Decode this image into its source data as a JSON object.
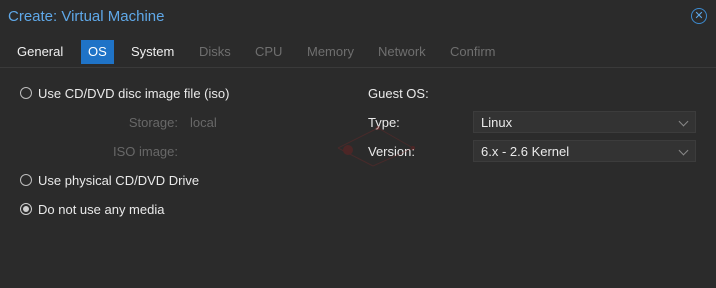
{
  "window": {
    "title": "Create: Virtual Machine",
    "close_icon": "close-circle-icon"
  },
  "tabs": [
    {
      "label": "General",
      "state": "enabled"
    },
    {
      "label": "OS",
      "state": "active"
    },
    {
      "label": "System",
      "state": "enabled"
    },
    {
      "label": "Disks",
      "state": "disabled"
    },
    {
      "label": "CPU",
      "state": "disabled"
    },
    {
      "label": "Memory",
      "state": "disabled"
    },
    {
      "label": "Network",
      "state": "disabled"
    },
    {
      "label": "Confirm",
      "state": "disabled"
    }
  ],
  "media": {
    "iso_option": {
      "label": "Use CD/DVD disc image file (iso)",
      "checked": false
    },
    "storage": {
      "label": "Storage:",
      "value": "local"
    },
    "iso_image": {
      "label": "ISO image:"
    },
    "physical_option": {
      "label": "Use physical CD/DVD Drive",
      "checked": false
    },
    "no_media_option": {
      "label": "Do not use any media",
      "checked": true
    }
  },
  "guest_os": {
    "heading": "Guest OS:",
    "type": {
      "label": "Type:",
      "value": "Linux"
    },
    "version": {
      "label": "Version:",
      "value": "6.x - 2.6 Kernel"
    }
  },
  "colors": {
    "accent": "#1f73c7",
    "title": "#5fa8e8",
    "background": "#2b2b2b"
  }
}
